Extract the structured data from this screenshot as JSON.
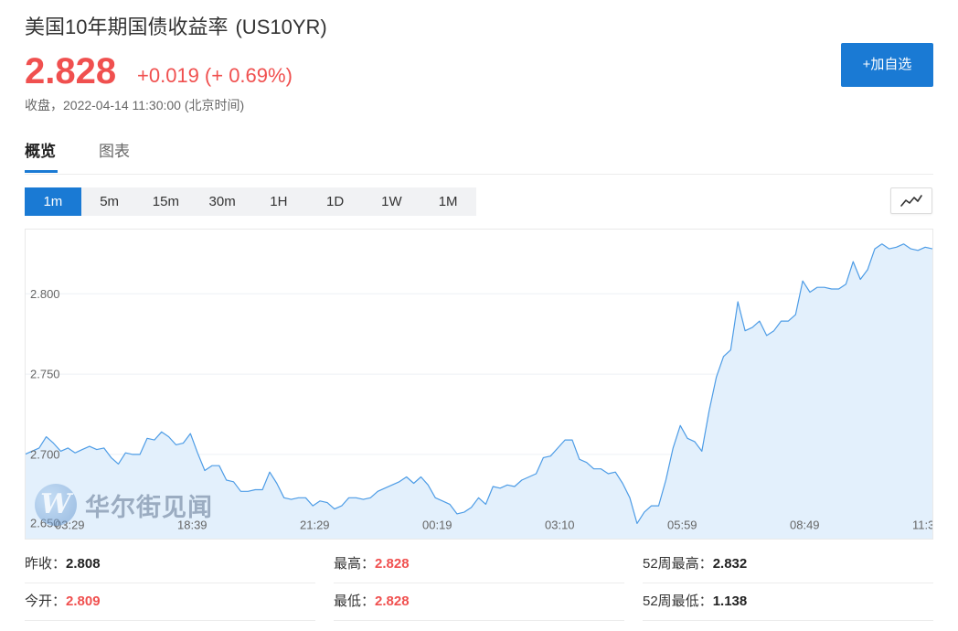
{
  "header": {
    "name": "美国10年期国债收益率",
    "code": "(US10YR)",
    "price": "2.828",
    "change": "+0.019",
    "change_percent": "(+ 0.69%)",
    "status_line": "收盘，2022-04-14 11:30:00 (北京时间)",
    "add_button_label": "+加自选"
  },
  "tabs": [
    {
      "label": "概览",
      "active": true
    },
    {
      "label": "图表",
      "active": false
    }
  ],
  "periods": [
    {
      "label": "1m",
      "active": true
    },
    {
      "label": "5m",
      "active": false
    },
    {
      "label": "15m",
      "active": false
    },
    {
      "label": "30m",
      "active": false
    },
    {
      "label": "1H",
      "active": false
    },
    {
      "label": "1D",
      "active": false
    },
    {
      "label": "1W",
      "active": false
    },
    {
      "label": "1M",
      "active": false
    }
  ],
  "chart_type_button": {
    "icon": "line-chart-icon"
  },
  "colors": {
    "red": "#f0504f",
    "blue": "#1a7ad4",
    "text": "#333333",
    "muted": "#666666",
    "line": "#4d9ce6",
    "fill": "#e3f0fc"
  },
  "watermark": {
    "logo_letter": "W",
    "text": "华尔街见闻"
  },
  "chart_data": {
    "type": "area",
    "series": [
      {
        "values": [
          2.7,
          2.702,
          2.704,
          2.711,
          2.707,
          2.702,
          2.704,
          2.701,
          2.703,
          2.705,
          2.703,
          2.704,
          2.698,
          2.694,
          2.701,
          2.7,
          2.7,
          2.71,
          2.709,
          2.714,
          2.711,
          2.706,
          2.707,
          2.713,
          2.701,
          2.69,
          2.693,
          2.693,
          2.684,
          2.683,
          2.677,
          2.677,
          2.678,
          2.678,
          2.689,
          2.682,
          2.673,
          2.672,
          2.673,
          2.673,
          2.668,
          2.671,
          2.67,
          2.666,
          2.668,
          2.673,
          2.673,
          2.672,
          2.673,
          2.677,
          2.679,
          2.681,
          2.683,
          2.686,
          2.682,
          2.686,
          2.681,
          2.673,
          2.671,
          2.669,
          2.663,
          2.664,
          2.667,
          2.673,
          2.669,
          2.68,
          2.679,
          2.681,
          2.68,
          2.684,
          2.686,
          2.688,
          2.698,
          2.699,
          2.704,
          2.709,
          2.709,
          2.697,
          2.695,
          2.691,
          2.691,
          2.688,
          2.689,
          2.682,
          2.673,
          2.657,
          2.664,
          2.668,
          2.668,
          2.684,
          2.704,
          2.718,
          2.71,
          2.708,
          2.702,
          2.727,
          2.748,
          2.761,
          2.765,
          2.795,
          2.777,
          2.779,
          2.783,
          2.774,
          2.777,
          2.783,
          2.783,
          2.787,
          2.808,
          2.801,
          2.804,
          2.804,
          2.803,
          2.803,
          2.806,
          2.82,
          2.809,
          2.815,
          2.828,
          2.831,
          2.828,
          2.829,
          2.831,
          2.828,
          2.827,
          2.829,
          2.828
        ]
      }
    ],
    "x_tick_labels": [
      "03:29",
      "18:39",
      "21:29",
      "00:19",
      "03:10",
      "05:59",
      "08:49",
      "11:3"
    ],
    "y_ticks": [
      "2.800",
      "2.750",
      "2.700",
      "2.650"
    ],
    "ylim": [
      2.647,
      2.84
    ],
    "grid": true
  },
  "stats": [
    {
      "label": "昨收：",
      "value": "2.808",
      "value_color": "#222222"
    },
    {
      "label": "最高：",
      "value": "2.828",
      "value_color": "#f0504f"
    },
    {
      "label": "52周最高：",
      "value": "2.832",
      "value_color": "#222222"
    },
    {
      "label": "今开：",
      "value": "2.809",
      "value_color": "#f0504f"
    },
    {
      "label": "最低：",
      "value": "2.828",
      "value_color": "#f0504f"
    },
    {
      "label": "52周最低：",
      "value": "1.138",
      "value_color": "#222222"
    }
  ]
}
